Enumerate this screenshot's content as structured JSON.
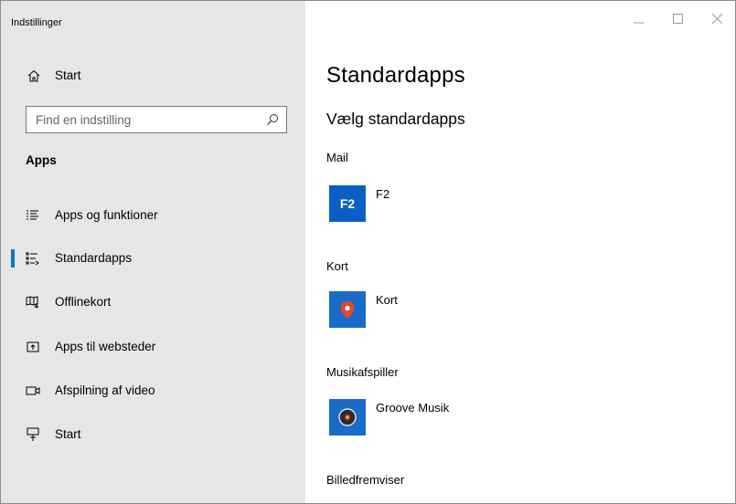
{
  "window": {
    "title": "Indstillinger"
  },
  "sidebar": {
    "home_label": "Start",
    "search": {
      "placeholder": "Find en indstilling"
    },
    "section_heading": "Apps",
    "items": [
      {
        "label": "Apps og funktioner",
        "icon": "list-icon",
        "selected": false
      },
      {
        "label": "Standardapps",
        "icon": "default-apps-icon",
        "selected": true
      },
      {
        "label": "Offlinekort",
        "icon": "offline-map-icon",
        "selected": false
      },
      {
        "label": "Apps til websteder",
        "icon": "web-apps-icon",
        "selected": false
      },
      {
        "label": "Afspilning af video",
        "icon": "video-icon",
        "selected": false
      },
      {
        "label": "Start",
        "icon": "startup-icon",
        "selected": false
      }
    ]
  },
  "main": {
    "title": "Standardapps",
    "subheading": "Vælg standardapps",
    "categories": [
      {
        "label": "Mail",
        "app": {
          "name": "F2",
          "tile_text": "F2",
          "icon": "f2-app-icon",
          "tile_color": "#0a5fc4"
        }
      },
      {
        "label": "Kort",
        "app": {
          "name": "Kort",
          "icon": "maps-app-icon",
          "tile_color": "#1a6ac9"
        }
      },
      {
        "label": "Musikafspiller",
        "app": {
          "name": "Groove Musik",
          "icon": "groove-music-icon",
          "tile_color": "#1a6ac9"
        }
      },
      {
        "label": "Billedfremviser"
      }
    ]
  },
  "colors": {
    "accent": "#0078d7",
    "sidebar_bg": "#e6e6e6",
    "content_bg": "#ffffff"
  }
}
